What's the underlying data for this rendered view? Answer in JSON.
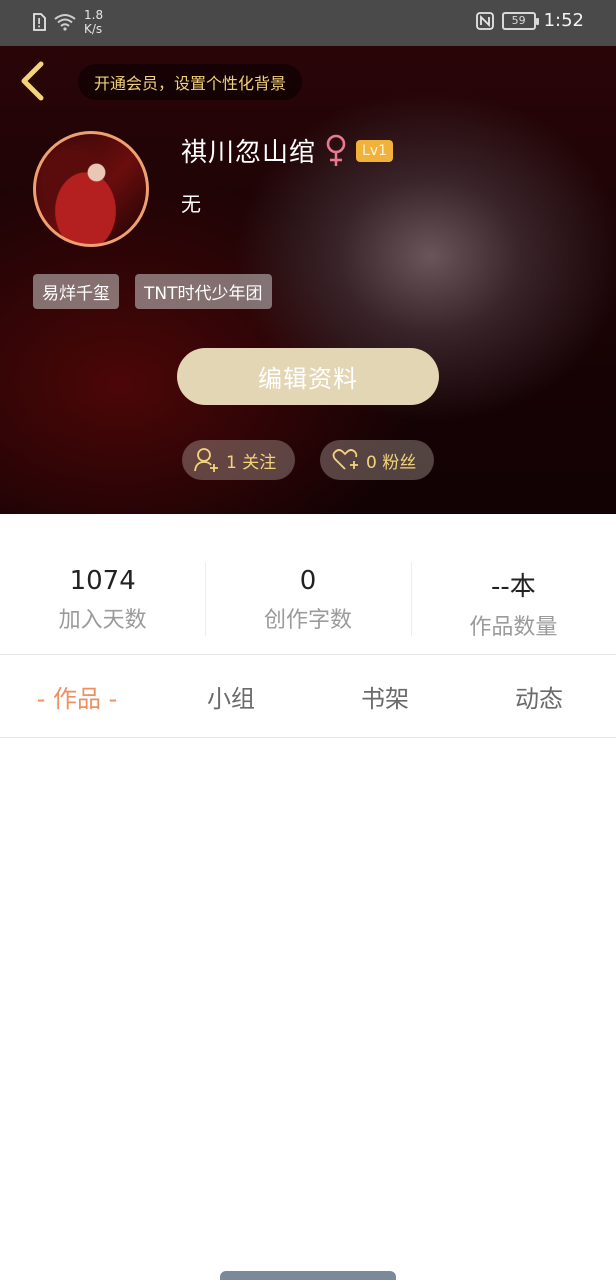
{
  "status_bar": {
    "speed_value": "1.8",
    "speed_unit": "K/s",
    "battery": "59",
    "time": "1:52"
  },
  "header": {
    "vip_prompt": "开通会员，设置个性化背景",
    "user_name": "祺川忽山绾",
    "level": "Lv1",
    "bio": "无",
    "tags": [
      "易烊千玺",
      "TNT时代少年团"
    ],
    "edit_button": "编辑资料",
    "follow": "1 关注",
    "fans": "0 粉丝"
  },
  "stats": [
    {
      "value": "1074",
      "label": "加入天数"
    },
    {
      "value": "0",
      "label": "创作字数"
    },
    {
      "value": "--本",
      "label": "作品数量"
    }
  ],
  "tabs": [
    {
      "label": "- 作品 -",
      "active": true
    },
    {
      "label": "小组",
      "active": false
    },
    {
      "label": "书架",
      "active": false
    },
    {
      "label": "动态",
      "active": false
    }
  ],
  "colors": {
    "accent": "#ef8f5f",
    "gold": "#f3d47c",
    "level_badge": "#f2b13a",
    "edit_button": "#e3d6b4",
    "female": "#e8798f"
  }
}
